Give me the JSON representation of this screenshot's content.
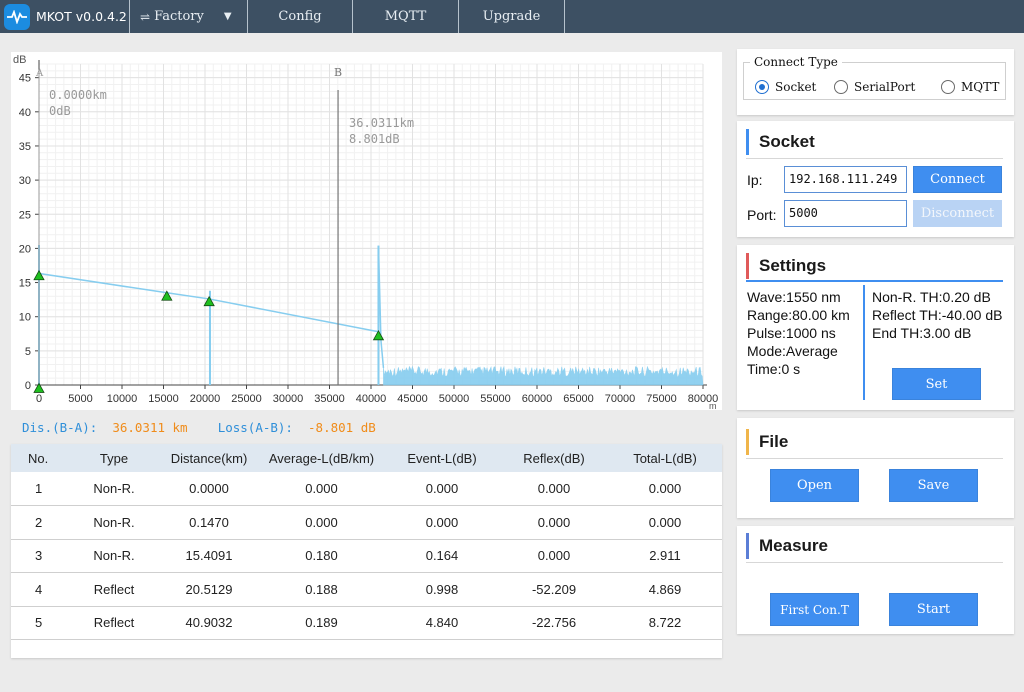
{
  "app": {
    "title": "MKOT v0.0.4.2"
  },
  "topbar": {
    "mode_label": "Factory",
    "menus": [
      "Config",
      "MQTT",
      "Upgrade"
    ]
  },
  "chart": {
    "x_unit": "m",
    "y_unit": "dB",
    "marker_a": {
      "label": "A",
      "distance": "0.0000km",
      "loss": "0dB"
    },
    "marker_b": {
      "label": "B",
      "distance": "36.0311km",
      "loss": "8.801dB"
    }
  },
  "chart_data": {
    "type": "line",
    "xlim": [
      0,
      80000
    ],
    "ylim": [
      0,
      47
    ],
    "x_ticks": [
      0,
      5000,
      10000,
      15000,
      20000,
      25000,
      30000,
      35000,
      40000,
      45000,
      50000,
      55000,
      60000,
      65000,
      70000,
      75000,
      80000
    ],
    "y_ticks": [
      0,
      5,
      10,
      15,
      20,
      25,
      30,
      35,
      40,
      45
    ],
    "grid": true,
    "color": "#86cdef",
    "trace": {
      "x": [
        0,
        150,
        15400,
        20500,
        40900
      ],
      "y": [
        16.4,
        16.3,
        13.5,
        12.6,
        7.8
      ]
    },
    "noise_floor": {
      "x_start": 41500,
      "x_end": 80000,
      "y_min": 1.2,
      "y_max": 2.7
    },
    "spikes": [
      {
        "x": 0,
        "y_top": 20.5
      },
      {
        "x": 20600,
        "y_top": 13.8
      },
      {
        "x": 40900,
        "y_top": 20.4
      }
    ],
    "events": [
      {
        "x": 0,
        "y": 16.0
      },
      {
        "x": 0,
        "y": -0.5
      },
      {
        "x": 15400,
        "y": 13.0
      },
      {
        "x": 20500,
        "y": 12.2
      },
      {
        "x": 40900,
        "y": 7.2
      }
    ],
    "marker_a_x": 0,
    "marker_b_x": 36031
  },
  "summary": {
    "dis_label": "Dis.(B-A):",
    "dis_value": "36.0311 km",
    "loss_label": "Loss(A-B):",
    "loss_value": "-8.801 dB"
  },
  "events_table": {
    "headers": [
      "No.",
      "Type",
      "Distance(km)",
      "Average-L(dB/km)",
      "Event-L(dB)",
      "Reflex(dB)",
      "Total-L(dB)"
    ],
    "rows": [
      [
        "1",
        "Non-R.",
        "0.0000",
        "0.000",
        "0.000",
        "0.000",
        "0.000"
      ],
      [
        "2",
        "Non-R.",
        "0.1470",
        "0.000",
        "0.000",
        "0.000",
        "0.000"
      ],
      [
        "3",
        "Non-R.",
        "15.4091",
        "0.180",
        "0.164",
        "0.000",
        "2.911"
      ],
      [
        "4",
        "Reflect",
        "20.5129",
        "0.188",
        "0.998",
        "-52.209",
        "4.869"
      ],
      [
        "5",
        "Reflect",
        "40.9032",
        "0.189",
        "4.840",
        "-22.756",
        "8.722"
      ]
    ]
  },
  "connect_type": {
    "legend": "Connect Type",
    "options": [
      "Socket",
      "SerialPort",
      "MQTT"
    ],
    "selected": "Socket"
  },
  "socket": {
    "title": "Socket",
    "ip_label": "Ip:",
    "ip_value": "192.168.111.249",
    "port_label": "Port:",
    "port_value": "5000",
    "connect_label": "Connect",
    "disconnect_label": "Disconnect"
  },
  "settings": {
    "title": "Settings",
    "left": [
      "Wave:1550 nm",
      "Range:80.00 km",
      "Pulse:1000 ns",
      "Mode:Average",
      "Time:0 s"
    ],
    "right": [
      "Non-R. TH:0.20 dB",
      "Reflect TH:-40.00 dB",
      "End TH:3.00 dB"
    ],
    "set_label": "Set"
  },
  "file": {
    "title": "File",
    "open_label": "Open",
    "save_label": "Save"
  },
  "measure": {
    "title": "Measure",
    "first_label": "First Con.T",
    "start_label": "Start"
  },
  "colors": {
    "topbar": "#3d5063",
    "accent": "#3f8ef0",
    "trace": "#86cdef",
    "orange": "#f08c1a",
    "connect_accent": "#3f8ef0",
    "settings_accent": "#e05a5a",
    "file_accent": "#f0b54a",
    "measure_accent": "#5b7ed6"
  }
}
